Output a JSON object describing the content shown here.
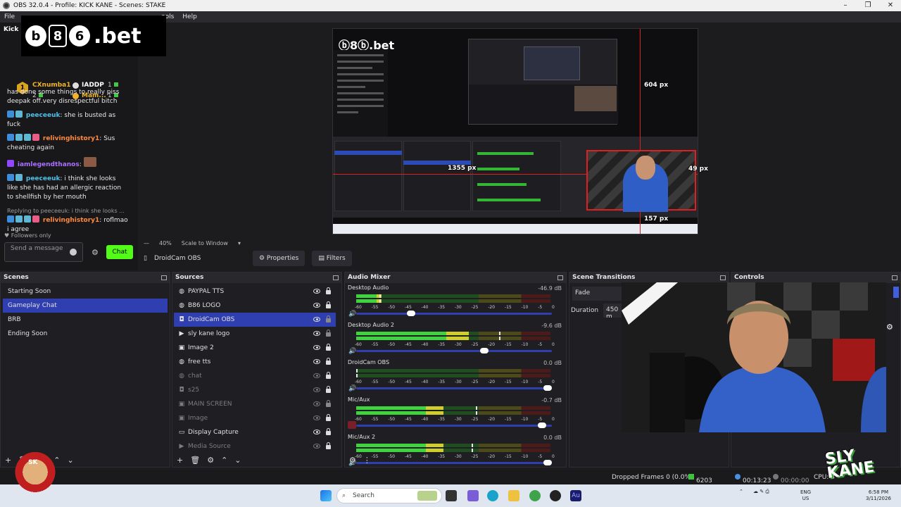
{
  "window": {
    "title": "OBS 32.0.4 - Profile: KICK KANE - Scenes: STAKE"
  },
  "menu": [
    "File",
    "Tools",
    "Help"
  ],
  "chat": {
    "header": "Kick c",
    "logo": {
      "b": "b",
      "eight": "8",
      "six": "6",
      "suffix": ".bet"
    },
    "leaderboard": [
      {
        "rank": "1",
        "name": "CXnumba1",
        "value": "1",
        "sub": "2"
      },
      {
        "name": "IADDP",
        "value": "1"
      },
      {
        "name": "Mam...",
        "value": "1"
      }
    ],
    "messages": [
      {
        "text": "has done some things to really piss deepak off.very disrespectful bitch"
      },
      {
        "user": "peeceeuk",
        "text": "she is busted as fuck"
      },
      {
        "user": "relivinghistory1",
        "text": "Sus cheating again"
      },
      {
        "user": "iamlegendthanos",
        "text": ""
      },
      {
        "user": "peeceeuk",
        "text": "i think she looks like she has had an allergic reaction to shellfish by her mouth"
      },
      {
        "reply": "Replying to peeceeuk: i think she looks ...",
        "user": "relivinghistory1",
        "text": "roflmao i agree"
      }
    ],
    "followers_only": "Followers only",
    "input_placeholder": "Send a message",
    "chat_button": "Chat"
  },
  "preview": {
    "measures": {
      "top": "604 px",
      "left": "1355 px",
      "right": "49 px",
      "bottom": "157 px"
    },
    "zoom": "40%",
    "scale_mode": "Scale to Window"
  },
  "source_toolbar": {
    "name": "DroidCam OBS",
    "properties": "Properties",
    "filters": "Filters"
  },
  "scenes": {
    "title": "Scenes",
    "items": [
      "Starting Soon",
      "Gameplay Chat",
      "BRB",
      "Ending Soon"
    ],
    "selected": 1
  },
  "sources": {
    "title": "Sources",
    "items": [
      {
        "name": "PAYPAL TTS",
        "icon": "globe-icon",
        "visible": true,
        "locked": true
      },
      {
        "name": "B86 LOGO",
        "icon": "globe-icon",
        "visible": true,
        "locked": true
      },
      {
        "name": "DroidCam OBS",
        "icon": "camera-icon",
        "visible": true,
        "locked": false
      },
      {
        "name": "sly kane logo",
        "icon": "play-icon",
        "visible": true,
        "locked": false
      },
      {
        "name": "Image 2",
        "icon": "image-icon",
        "visible": true,
        "locked": true
      },
      {
        "name": "free tts",
        "icon": "globe-icon",
        "visible": true,
        "locked": true
      },
      {
        "name": "chat",
        "icon": "globe-icon",
        "visible": false,
        "locked": true
      },
      {
        "name": "s25",
        "icon": "camera-icon",
        "visible": false,
        "locked": true
      },
      {
        "name": "MAIN SCREEN",
        "icon": "image-icon",
        "visible": false,
        "locked": false
      },
      {
        "name": "Image",
        "icon": "image-icon",
        "visible": false,
        "locked": true
      },
      {
        "name": "Display Capture",
        "icon": "monitor-icon",
        "visible": true,
        "locked": true
      },
      {
        "name": "Media Source",
        "icon": "play-icon",
        "visible": false,
        "locked": true
      }
    ]
  },
  "mixer": {
    "title": "Audio Mixer",
    "ticks": [
      "-60",
      "-55",
      "-50",
      "-45",
      "-40",
      "-35",
      "-30",
      "-25",
      "-20",
      "-15",
      "-10",
      "-5",
      "0"
    ],
    "channels": [
      {
        "name": "Desktop Audio",
        "db": "-46.9 dB",
        "level": 0.13,
        "peak": 0.12,
        "volume": 0.27,
        "muted": false
      },
      {
        "name": "Desktop Audio 2",
        "db": "-9.6 dB",
        "level": 0.58,
        "peak": 0.74,
        "volume": 0.66,
        "muted": false
      },
      {
        "name": "DroidCam OBS",
        "db": "0.0 dB",
        "level": 0.0,
        "peak": 0.0,
        "volume": 1.0,
        "muted": false
      },
      {
        "name": "Mic/Aux",
        "db": "-0.7 dB",
        "level": 0.45,
        "peak": 0.62,
        "volume": 0.97,
        "muted": true
      },
      {
        "name": "Mic/Aux 2",
        "db": "0.0 dB",
        "level": 0.45,
        "peak": 0.6,
        "volume": 1.0,
        "muted": false
      }
    ]
  },
  "transitions": {
    "title": "Scene Transitions",
    "type": "Fade",
    "duration_label": "Duration",
    "duration": "450 m"
  },
  "controls": {
    "title": "Controls"
  },
  "status": {
    "dropped": "Dropped Frames 0 (0.0%)",
    "bitrate": "6203 kbps",
    "live_time": "00:13:23",
    "rec_time": "00:00:00",
    "cpu": "CPU: 3"
  },
  "taskbar": {
    "search": "Search",
    "lang": "ENG",
    "region": "US",
    "time": "6:58 PM",
    "date": "3/11/2026"
  },
  "overlay": {
    "brand": "SLY KANE",
    "avatar_text": "SK"
  }
}
